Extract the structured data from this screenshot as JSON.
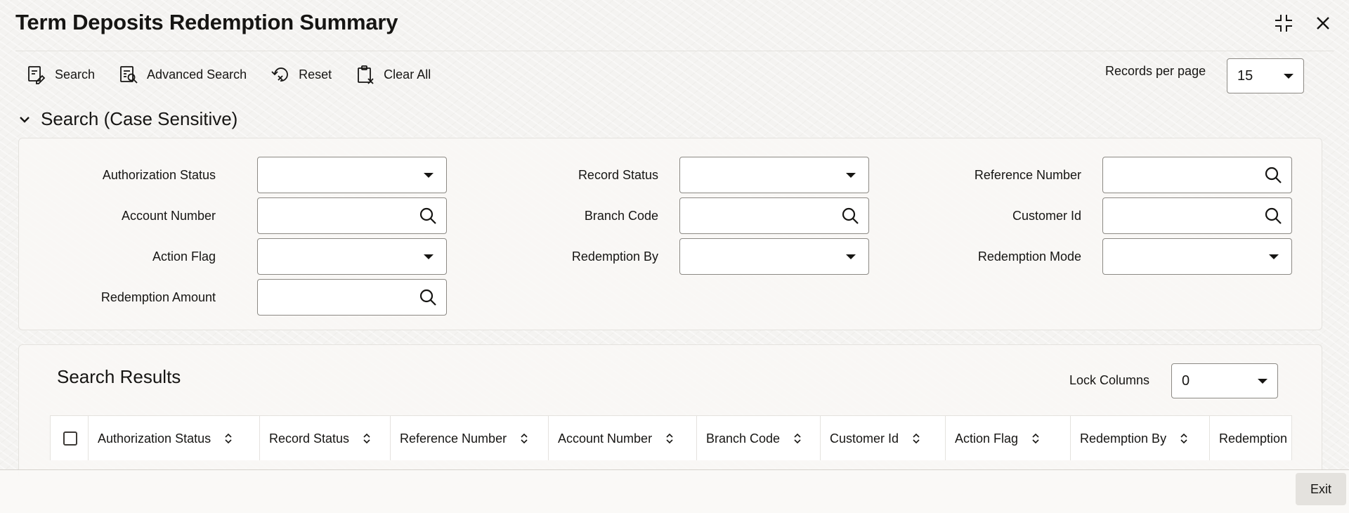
{
  "page": {
    "title": "Term Deposits Redemption Summary"
  },
  "toolbar": {
    "search": "Search",
    "advanced_search": "Advanced Search",
    "reset": "Reset",
    "clear_all": "Clear All"
  },
  "records_per_page": {
    "label": "Records per page",
    "value": "15"
  },
  "search_section": {
    "title": "Search (Case Sensitive)",
    "fields": {
      "authorization_status": "Authorization Status",
      "record_status": "Record Status",
      "reference_number": "Reference Number",
      "account_number": "Account Number",
      "branch_code": "Branch Code",
      "customer_id": "Customer Id",
      "action_flag": "Action Flag",
      "redemption_by": "Redemption By",
      "redemption_mode": "Redemption Mode",
      "redemption_amount": "Redemption Amount"
    }
  },
  "results": {
    "title": "Search Results",
    "lock_columns": {
      "label": "Lock Columns",
      "value": "0"
    },
    "columns": [
      "Authorization Status",
      "Record Status",
      "Reference Number",
      "Account Number",
      "Branch Code",
      "Customer Id",
      "Action Flag",
      "Redemption By",
      "Redemption"
    ]
  },
  "footer": {
    "exit": "Exit"
  },
  "icons": {
    "maximize": "maximize-icon",
    "close": "close-icon",
    "search": "search-icon",
    "chevron": "chevron-down-icon",
    "sort": "sort-icon"
  }
}
